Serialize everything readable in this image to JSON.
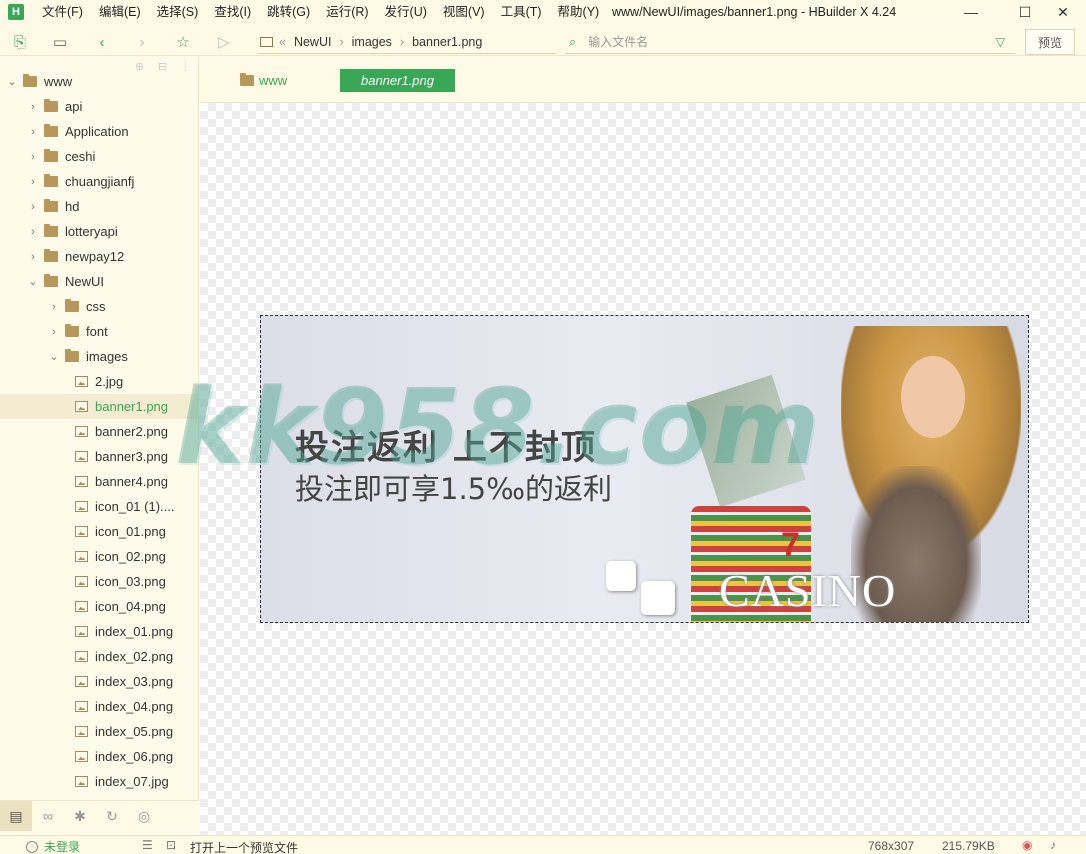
{
  "app": {
    "logo_letter": "H",
    "window_title": "www/NewUI/images/banner1.png - HBuilder X 4.24"
  },
  "menu": [
    "文件(F)",
    "编辑(E)",
    "选择(S)",
    "查找(I)",
    "跳转(G)",
    "运行(R)",
    "发行(U)",
    "视图(V)",
    "工具(T)",
    "帮助(Y)"
  ],
  "window_controls": {
    "minimize": "—",
    "maximize": "☐",
    "close": "✕"
  },
  "toolbar": {
    "breadcrumb": [
      "NewUI",
      "images",
      "banner1.png"
    ],
    "breadcrumb_prefix": "«",
    "search_placeholder": "输入文件名",
    "preview_label": "预览"
  },
  "tree": [
    {
      "label": "www",
      "type": "root",
      "expanded": true
    },
    {
      "label": "api",
      "type": "folder"
    },
    {
      "label": "Application",
      "type": "folder"
    },
    {
      "label": "ceshi",
      "type": "folder"
    },
    {
      "label": "chuangjianfj",
      "type": "folder"
    },
    {
      "label": "hd",
      "type": "folder"
    },
    {
      "label": "lotteryapi",
      "type": "folder"
    },
    {
      "label": "newpay12",
      "type": "folder"
    },
    {
      "label": "NewUI",
      "type": "folder",
      "expanded": true
    },
    {
      "label": "css",
      "type": "folder"
    },
    {
      "label": "font",
      "type": "folder"
    },
    {
      "label": "images",
      "type": "folder",
      "expanded": true
    },
    {
      "label": "2.jpg",
      "type": "file"
    },
    {
      "label": "banner1.png",
      "type": "file",
      "selected": true
    },
    {
      "label": "banner2.png",
      "type": "file"
    },
    {
      "label": "banner3.png",
      "type": "file"
    },
    {
      "label": "banner4.png",
      "type": "file"
    },
    {
      "label": "icon_01 (1)....",
      "type": "file"
    },
    {
      "label": "icon_01.png",
      "type": "file"
    },
    {
      "label": "icon_02.png",
      "type": "file"
    },
    {
      "label": "icon_03.png",
      "type": "file"
    },
    {
      "label": "icon_04.png",
      "type": "file"
    },
    {
      "label": "index_01.png",
      "type": "file"
    },
    {
      "label": "index_02.png",
      "type": "file"
    },
    {
      "label": "index_03.png",
      "type": "file"
    },
    {
      "label": "index_04.png",
      "type": "file"
    },
    {
      "label": "index_05.png",
      "type": "file"
    },
    {
      "label": "index_06.png",
      "type": "file"
    },
    {
      "label": "index_07.jpg",
      "type": "file"
    }
  ],
  "tabs": {
    "project": "www",
    "active": "banner1.png"
  },
  "banner": {
    "headline": "投注返利 上不封顶",
    "subline": "投注即可享1.5‰的返利",
    "casino_text": "CASINO",
    "slot_digit": "7"
  },
  "watermark": "kk958.com",
  "status": {
    "user": "未登录",
    "message": "打开上一个预览文件",
    "dimensions": "768x307",
    "file_size": "215.79KB"
  }
}
